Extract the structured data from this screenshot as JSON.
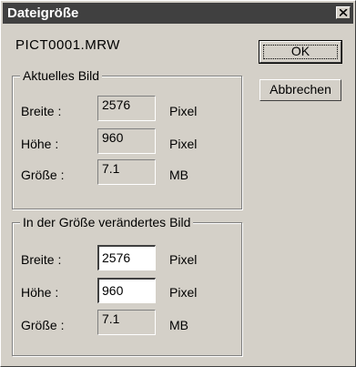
{
  "window": {
    "title": "Dateigröße"
  },
  "file": {
    "name": "PICT0001.MRW"
  },
  "buttons": {
    "ok": "OK",
    "cancel": "Abbrechen"
  },
  "current": {
    "group_label": "Aktuelles Bild",
    "width_label": "Breite :",
    "width_value": "2576",
    "width_unit": "Pixel",
    "height_label": "Höhe :",
    "height_value": "960",
    "height_unit": "Pixel",
    "size_label": "Größe :",
    "size_value": "7.1",
    "size_unit": "MB"
  },
  "resized": {
    "group_label": "In der Größe verändertes Bild",
    "width_label": "Breite :",
    "width_value": "2576",
    "width_unit": "Pixel",
    "height_label": "Höhe :",
    "height_value": "960",
    "height_unit": "Pixel",
    "size_label": "Größe :",
    "size_value": "7.1",
    "size_unit": "MB"
  }
}
